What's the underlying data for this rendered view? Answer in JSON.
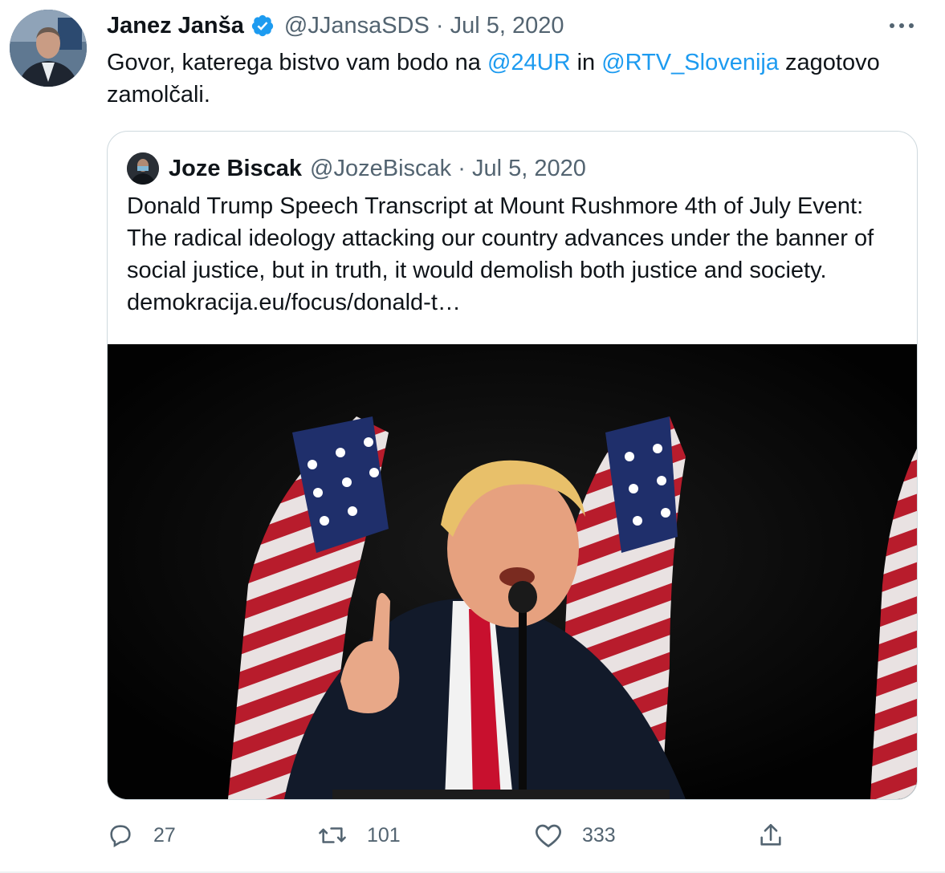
{
  "author": {
    "name": "Janez Janša",
    "handle": "@JJansaSDS",
    "date": "Jul 5, 2020",
    "verified": true
  },
  "tweet": {
    "text_part1": "Govor, katerega bistvo vam bodo na ",
    "mention1": "@24UR",
    "text_part2": " in ",
    "mention2": "@RTV_Slovenija",
    "text_part3": " zagotovo zamolčali."
  },
  "quoted": {
    "name": "Joze Biscak",
    "handle": "@JozeBiscak",
    "date": "Jul 5, 2020",
    "text": "Donald Trump Speech Transcript at Mount Rushmore 4th of July Event: The radical ideology attacking our country advances under the banner of social justice, but in truth, it would demolish both justice and society. demokracija.eu/focus/donald-t…"
  },
  "actions": {
    "replies": "27",
    "retweets": "101",
    "likes": "333"
  },
  "icons": {
    "verified": "verified-badge-icon",
    "more": "more-horizontal-icon",
    "reply": "reply-icon",
    "retweet": "retweet-icon",
    "like": "heart-icon",
    "share": "share-icon"
  },
  "colors": {
    "accent": "#1d9bf0",
    "muted": "#536471",
    "border": "#cfd9de"
  }
}
